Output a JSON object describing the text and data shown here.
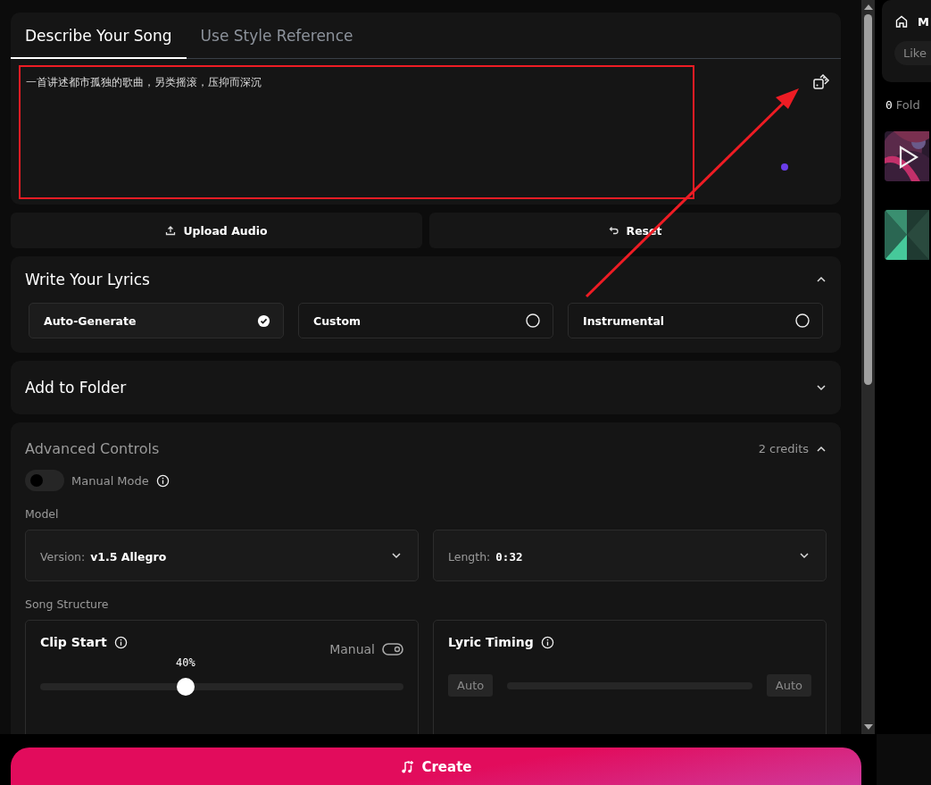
{
  "tabs": [
    {
      "label": "Describe Your Song",
      "selected": true
    },
    {
      "label": "Use Style Reference",
      "selected": false
    }
  ],
  "description": {
    "value": "一首讲述都市孤独的歌曲，另类摇滚，压抑而深沉"
  },
  "actions": [
    {
      "label": "Upload Audio",
      "kind": "upload"
    },
    {
      "label": "Reset",
      "kind": "reset"
    }
  ],
  "lyrics": {
    "title": "Write Your Lyrics",
    "expanded": true,
    "options": [
      {
        "label": "Auto-Generate",
        "selected": true
      },
      {
        "label": "Custom",
        "selected": false
      },
      {
        "label": "Instrumental",
        "selected": false
      }
    ]
  },
  "folder": {
    "title": "Add to Folder",
    "expanded": false
  },
  "advanced": {
    "title": "Advanced Controls",
    "credits": "2 credits",
    "expanded": true,
    "manual_mode": {
      "label": "Manual Mode",
      "on": false
    },
    "model_label": "Model",
    "version": {
      "label": "Version:",
      "value": "v1.5 Allegro"
    },
    "length": {
      "label": "Length:",
      "value": "0:32"
    },
    "structure_label": "Song Structure",
    "clip_start": {
      "title": "Clip Start",
      "manual_label": "Manual",
      "reading": "40%",
      "level": 0.4
    },
    "lyric_timing": {
      "title": "Lyric Timing",
      "start": "Auto",
      "end": "Auto"
    }
  },
  "create": {
    "label": "Create"
  },
  "sidebar": {
    "title": "M",
    "filter": "Like",
    "folders_count": "0",
    "folders_label": "Fold",
    "tracks": [
      {
        "kind": "picture",
        "playable": true
      },
      {
        "kind": "picture",
        "playable": false
      }
    ]
  }
}
